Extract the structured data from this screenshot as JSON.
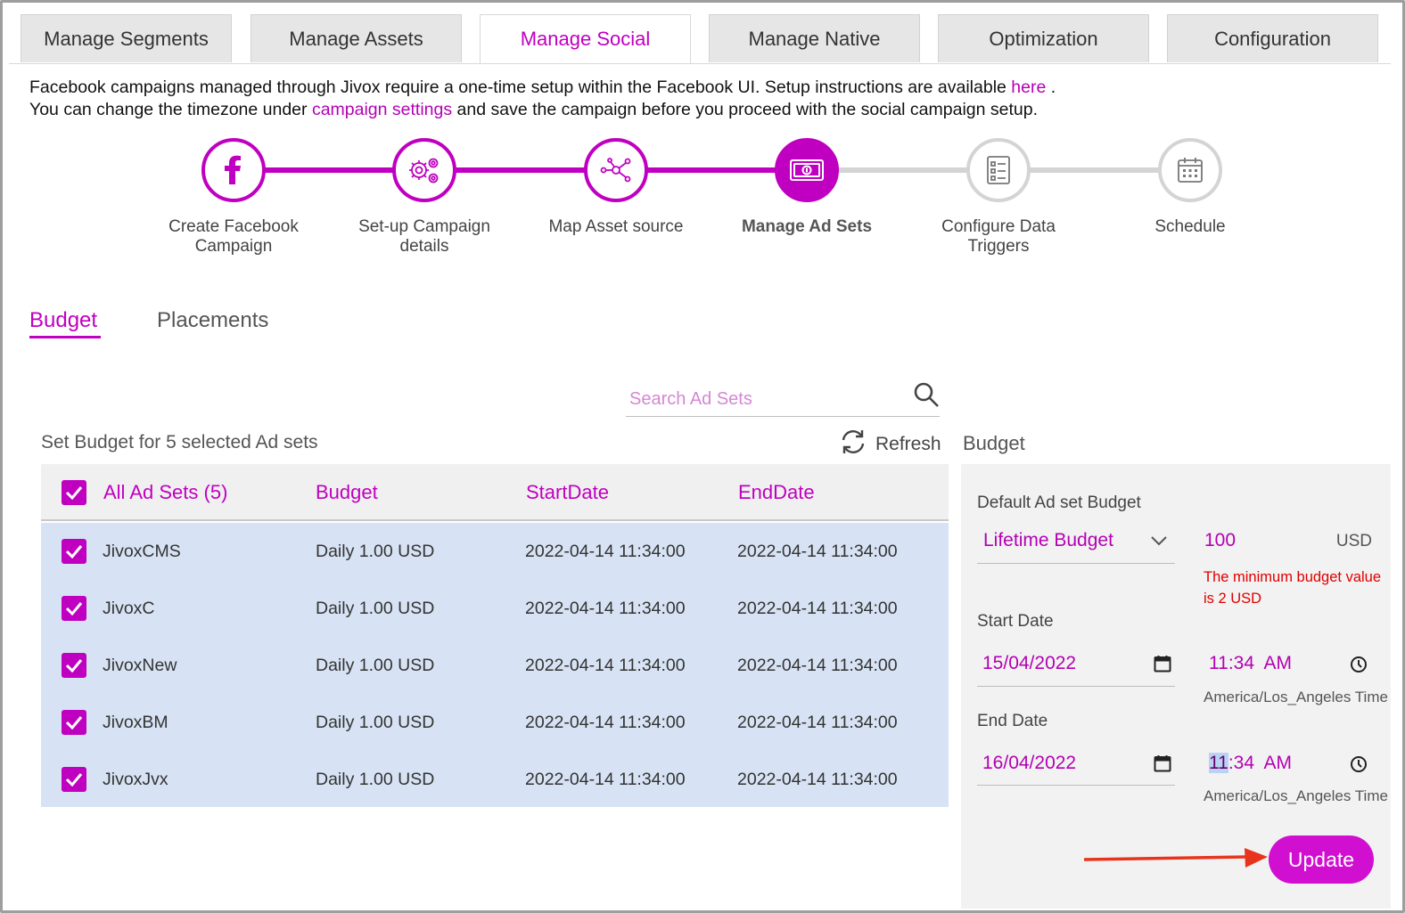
{
  "tabs": [
    "Manage Segments",
    "Manage Assets",
    "Manage Social",
    "Manage Native",
    "Optimization",
    "Configuration"
  ],
  "active_tab": "Manage Social",
  "intro": {
    "line1_text": "Facebook campaigns managed through Jivox require a one-time setup within the Facebook UI. Setup instructions are available ",
    "line1_link": "here",
    "line1_end": " .",
    "line2_start": "You can change the timezone under ",
    "line2_link": "campaign settings",
    "line2_end": " and save the campaign before you proceed with the social campaign setup."
  },
  "steps": [
    {
      "label_1": "Create Facebook",
      "label_2": "Campaign",
      "icon": "facebook-icon",
      "state": "done"
    },
    {
      "label_1": "Set-up Campaign",
      "label_2": "details",
      "icon": "gears-icon",
      "state": "done"
    },
    {
      "label_1": "Map Asset source",
      "label_2": "",
      "icon": "network-icon",
      "state": "done"
    },
    {
      "label_1": "Manage Ad Sets",
      "label_2": "",
      "icon": "money-icon",
      "state": "current"
    },
    {
      "label_1": "Configure Data",
      "label_2": "Triggers",
      "icon": "checklist-icon",
      "state": "todo"
    },
    {
      "label_1": "Schedule",
      "label_2": "",
      "icon": "calendar-icon",
      "state": "todo"
    }
  ],
  "subtabs": {
    "budget": "Budget",
    "placements": "Placements"
  },
  "search": {
    "placeholder": "Search Ad Sets"
  },
  "table_title": "Set Budget for 5 selected Ad sets",
  "refresh_label": "Refresh",
  "table": {
    "headers": [
      "All Ad Sets (5)",
      "Budget",
      "StartDate",
      "EndDate"
    ],
    "rows": [
      {
        "name": "JivoxCMS",
        "budget": "Daily 1.00 USD",
        "start": "2022-04-14 11:34:00",
        "end": "2022-04-14 11:34:00"
      },
      {
        "name": "JivoxC",
        "budget": "Daily 1.00 USD",
        "start": "2022-04-14 11:34:00",
        "end": "2022-04-14 11:34:00"
      },
      {
        "name": "JivoxNew",
        "budget": "Daily 1.00 USD",
        "start": "2022-04-14 11:34:00",
        "end": "2022-04-14 11:34:00"
      },
      {
        "name": "JivoxBM",
        "budget": "Daily 1.00 USD",
        "start": "2022-04-14 11:34:00",
        "end": "2022-04-14 11:34:00"
      },
      {
        "name": "JivoxJvx",
        "budget": "Daily 1.00 USD",
        "start": "2022-04-14 11:34:00",
        "end": "2022-04-14 11:34:00"
      }
    ]
  },
  "panel": {
    "title": "Budget",
    "default_label": "Default Ad set Budget",
    "budget_type": "Lifetime Budget",
    "amount": "100",
    "currency": "USD",
    "error": "The minimum budget value is 2 USD",
    "start_label": "Start Date",
    "start_date": "15/04/2022",
    "start_time_h": "11",
    "start_time_rest": ":34  AM",
    "end_label": "End Date",
    "end_date": "16/04/2022",
    "end_time_h": "11",
    "end_time_rest": ":34  AM",
    "timezone": "America/Los_Angeles Time",
    "update_label": "Update"
  },
  "colors": {
    "accent": "#c000c0",
    "row_bg": "#d7e3f4",
    "arrow": "#e8341c"
  }
}
